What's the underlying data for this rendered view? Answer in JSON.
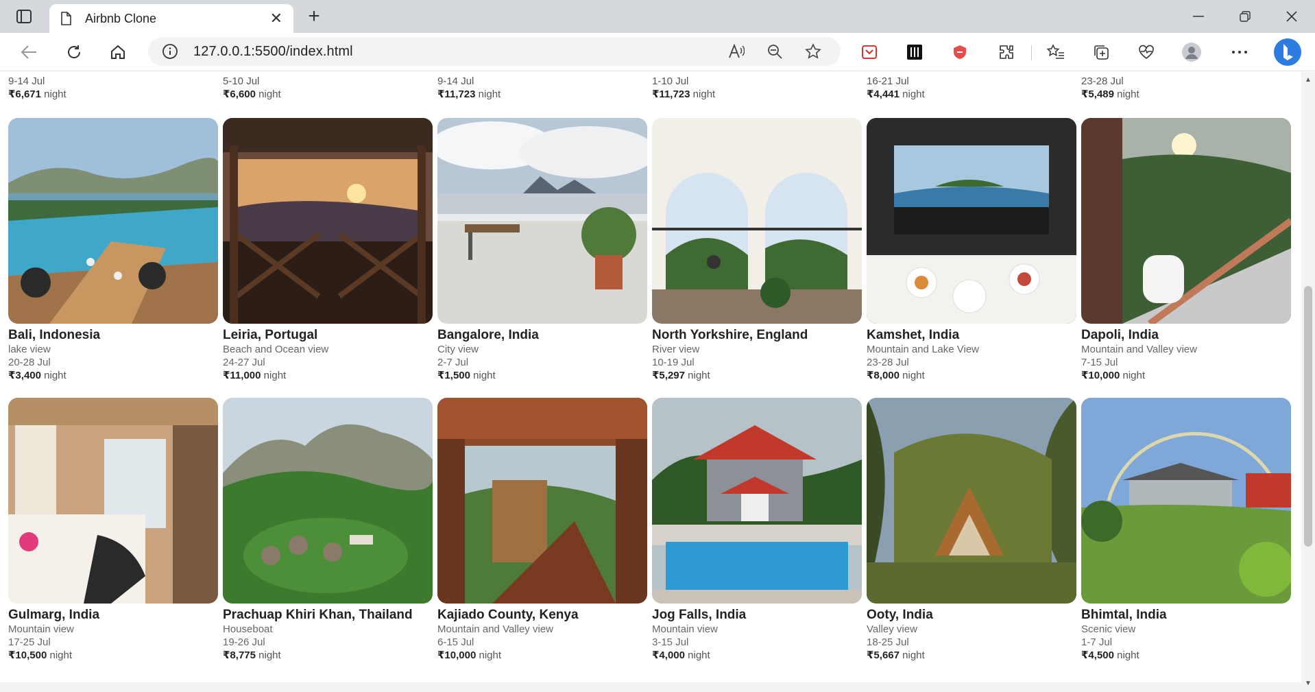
{
  "browser": {
    "tab_title": "Airbnb Clone",
    "url": "127.0.0.1:5500/index.html"
  },
  "top_row": [
    {
      "dates": "9-14 Jul",
      "price": "₹6,671",
      "unit": "night"
    },
    {
      "dates": "5-10 Jul",
      "price": "₹6,600",
      "unit": "night"
    },
    {
      "dates": "9-14 Jul",
      "price": "₹11,723",
      "unit": "night"
    },
    {
      "dates": "1-10 Jul",
      "price": "₹11,723",
      "unit": "night"
    },
    {
      "dates": "16-21 Jul",
      "price": "₹4,441",
      "unit": "night"
    },
    {
      "dates": "23-28 Jul",
      "price": "₹5,489",
      "unit": "night"
    }
  ],
  "listings": [
    {
      "location": "Bali, Indonesia",
      "view": "lake view",
      "dates": "20-28 Jul",
      "price": "₹3,400",
      "unit": "night",
      "scene": "pool"
    },
    {
      "location": "Leiria, Portugal",
      "view": "Beach and Ocean view",
      "dates": "24-27 Jul",
      "price": "₹11,000",
      "unit": "night",
      "scene": "sunset"
    },
    {
      "location": "Bangalore, India",
      "view": "City view",
      "dates": "2-7 Jul",
      "price": "₹1,500",
      "unit": "night",
      "scene": "terrace"
    },
    {
      "location": "North Yorkshire, England",
      "view": "River view",
      "dates": "10-19 Jul",
      "price": "₹5,297",
      "unit": "night",
      "scene": "arches"
    },
    {
      "location": "Kamshet, India",
      "view": "Mountain and Lake View",
      "dates": "23-28 Jul",
      "price": "₹8,000",
      "unit": "night",
      "scene": "breakfast"
    },
    {
      "location": "Dapoli, India",
      "view": "Mountain and Valley view",
      "dates": "7-15 Jul",
      "price": "₹10,000",
      "unit": "night",
      "scene": "balcony"
    },
    {
      "location": "Gulmarg, India",
      "view": "Mountain view",
      "dates": "17-25 Jul",
      "price": "₹10,500",
      "unit": "night",
      "scene": "bedroom"
    },
    {
      "location": "Prachuap Khiri Khan, Thailand",
      "view": "Houseboat",
      "dates": "19-26 Jul",
      "price": "₹8,775",
      "unit": "night",
      "scene": "jungle"
    },
    {
      "location": "Kajiado County, Kenya",
      "view": "Mountain and Valley view",
      "dates": "6-15 Jul",
      "price": "₹10,000",
      "unit": "night",
      "scene": "doorway"
    },
    {
      "location": "Jog Falls, India",
      "view": "Mountain view",
      "dates": "3-15 Jul",
      "price": "₹4,000",
      "unit": "night",
      "scene": "villa"
    },
    {
      "location": "Ooty, India",
      "view": "Valley view",
      "dates": "18-25 Jul",
      "price": "₹5,667",
      "unit": "night",
      "scene": "aframe"
    },
    {
      "location": "Bhimtal, India",
      "view": "Scenic view",
      "dates": "1-7 Jul",
      "price": "₹4,500",
      "unit": "night",
      "scene": "lawn"
    }
  ]
}
